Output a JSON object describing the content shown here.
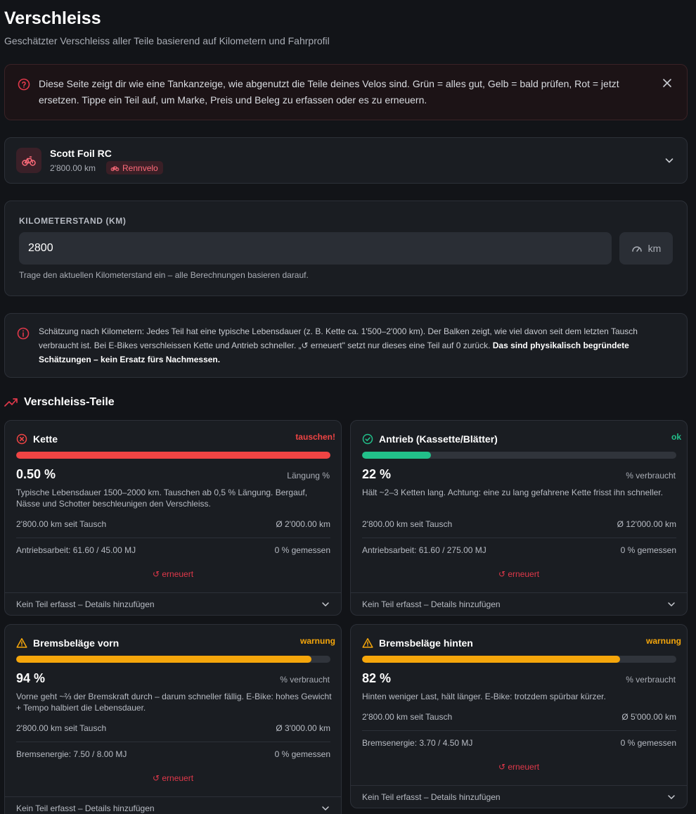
{
  "page": {
    "title": "Verschleiss",
    "subtitle": "Geschätzter Verschleiss aller Teile basierend auf Kilometern und Fahrprofil"
  },
  "help": {
    "text": "Diese Seite zeigt dir wie eine Tankanzeige, wie abgenutzt die Teile deines Velos sind. Grün = alles gut, Gelb = bald prüfen, Rot = jetzt ersetzen. Tippe ein Teil auf, um Marke, Preis und Beleg zu erfassen oder es zu erneuern."
  },
  "bike": {
    "name": "Scott Foil RC",
    "km": "2'800.00 km",
    "tag": "Rennvelo"
  },
  "odometer": {
    "label": "KILOMETERSTAND (KM)",
    "value": "2800",
    "unit": "km",
    "hint": "Trage den aktuellen Kilometerstand ein – alle Berechnungen basieren darauf."
  },
  "info": {
    "text": "Schätzung nach Kilometern: Jedes Teil hat eine typische Lebensdauer (z. B. Kette ca. 1'500–2'000 km). Der Balken zeigt, wie viel davon seit dem letzten Tausch verbraucht ist. Bei E-Bikes verschleissen Kette und Antrieb schneller. „↺ erneuert\" setzt nur dieses eine Teil auf 0 zurück. ",
    "bold": "Das sind physikalisch begründete Schätzungen – kein Ersatz fürs Nachmessen."
  },
  "section": {
    "title": "Verschleiss-Teile"
  },
  "colors": {
    "red": "#ef4444",
    "green": "#22c08a",
    "orange": "#f5a60b"
  },
  "parts": [
    {
      "name": "Kette",
      "status": "tauschen!",
      "level": "red",
      "fill": 1.0,
      "value": "0.50 %",
      "unit": "Längung %",
      "desc": "Typische Lebensdauer 1500–2000 km. Tauschen ab 0,5 % Längung. Bergauf, Nässe und Schotter beschleunigen den Verschleiss.",
      "since": "2'800.00 km seit Tausch",
      "avg": "Ø 2'000.00 km",
      "energy": "Antriebsarbeit: 61.60 / 45.00 MJ",
      "measured": "0 % gemessen",
      "renew": "erneuert",
      "footer": "Kein Teil erfasst – Details hinzufügen"
    },
    {
      "name": "Antrieb (Kassette/Blätter)",
      "status": "ok",
      "level": "green",
      "fill": 0.22,
      "value": "22 %",
      "unit": "% verbraucht",
      "desc": "Hält ~2–3 Ketten lang. Achtung: eine zu lang gefahrene Kette frisst ihn schneller.",
      "since": "2'800.00 km seit Tausch",
      "avg": "Ø 12'000.00 km",
      "energy": "Antriebsarbeit: 61.60 / 275.00 MJ",
      "measured": "0 % gemessen",
      "renew": "erneuert",
      "footer": "Kein Teil erfasst – Details hinzufügen"
    },
    {
      "name": "Bremsbeläge vorn",
      "status": "warnung",
      "level": "orange",
      "fill": 0.94,
      "value": "94 %",
      "unit": "% verbraucht",
      "desc": "Vorne geht ~⅔ der Bremskraft durch – darum schneller fällig. E-Bike: hohes Gewicht + Tempo halbiert die Lebensdauer.",
      "since": "2'800.00 km seit Tausch",
      "avg": "Ø 3'000.00 km",
      "energy": "Bremsenergie: 7.50 / 8.00 MJ",
      "measured": "0 % gemessen",
      "renew": "erneuert",
      "footer": "Kein Teil erfasst – Details hinzufügen"
    },
    {
      "name": "Bremsbeläge hinten",
      "status": "warnung",
      "level": "orange",
      "fill": 0.82,
      "value": "82 %",
      "unit": "% verbraucht",
      "desc": "Hinten weniger Last, hält länger. E-Bike: trotzdem spürbar kürzer.",
      "since": "2'800.00 km seit Tausch",
      "avg": "Ø 5'000.00 km",
      "energy": "Bremsenergie: 3.70 / 4.50 MJ",
      "measured": "0 % gemessen",
      "renew": "erneuert",
      "footer": "Kein Teil erfasst – Details hinzufügen"
    }
  ]
}
